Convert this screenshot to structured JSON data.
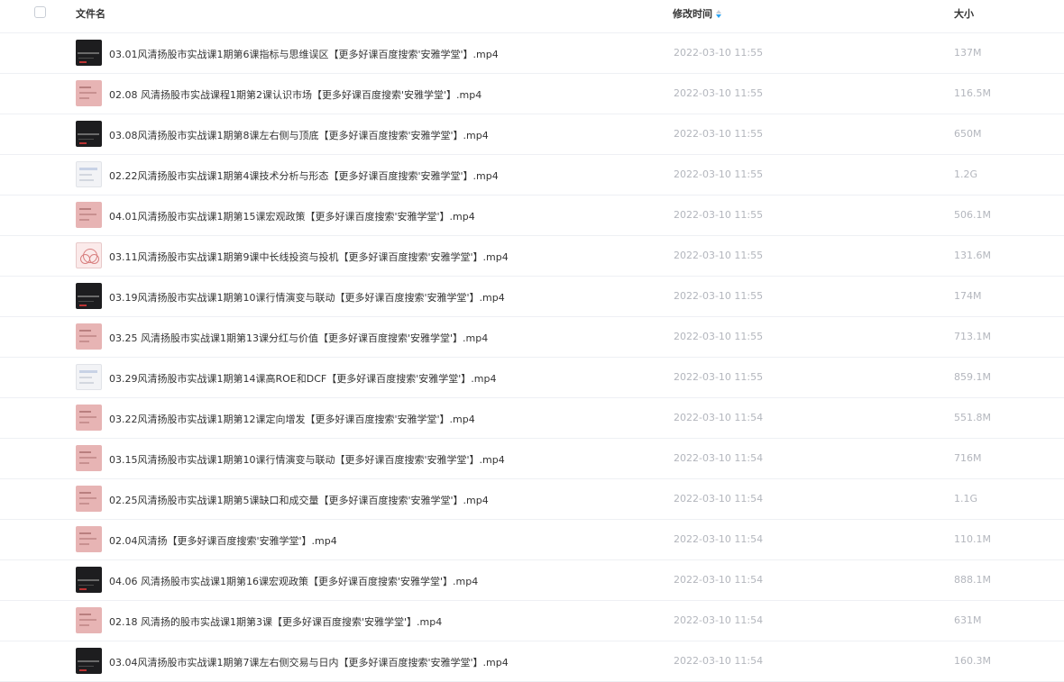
{
  "header": {
    "name_label": "文件名",
    "time_label": "修改时间",
    "size_label": "大小"
  },
  "files": [
    {
      "name": "03.01风清扬股市实战课1期第6课指标与思维误区【更多好课百度搜索'安雅学堂'】.mp4",
      "time": "2022-03-10 11:55",
      "size": "137M",
      "thumb": "dark"
    },
    {
      "name": "02.08 风清扬股市实战课程1期第2课认识市场【更多好课百度搜索'安雅学堂'】.mp4",
      "time": "2022-03-10 11:55",
      "size": "116.5M",
      "thumb": "pink"
    },
    {
      "name": "03.08风清扬股市实战课1期第8课左右侧与顶底【更多好课百度搜索'安雅学堂'】.mp4",
      "time": "2022-03-10 11:55",
      "size": "650M",
      "thumb": "dark"
    },
    {
      "name": "02.22风清扬股市实战课1期第4课技术分析与形态【更多好课百度搜索'安雅学堂'】.mp4",
      "time": "2022-03-10 11:55",
      "size": "1.2G",
      "thumb": "light"
    },
    {
      "name": "04.01风清扬股市实战课1期第15课宏观政策【更多好课百度搜索'安雅学堂'】.mp4",
      "time": "2022-03-10 11:55",
      "size": "506.1M",
      "thumb": "pink"
    },
    {
      "name": "03.11风清扬股市实战课1期第9课中长线投资与投机【更多好课百度搜索'安雅学堂'】.mp4",
      "time": "2022-03-10 11:55",
      "size": "131.6M",
      "thumb": "diagram"
    },
    {
      "name": "03.19风清扬股市实战课1期第10课行情演变与联动【更多好课百度搜索'安雅学堂'】.mp4",
      "time": "2022-03-10 11:55",
      "size": "174M",
      "thumb": "dark"
    },
    {
      "name": "03.25 风清扬股市实战课1期第13课分红与价值【更多好课百度搜索'安雅学堂'】.mp4",
      "time": "2022-03-10 11:55",
      "size": "713.1M",
      "thumb": "pink"
    },
    {
      "name": "03.29风清扬股市实战课1期第14课高ROE和DCF【更多好课百度搜索'安雅学堂'】.mp4",
      "time": "2022-03-10 11:55",
      "size": "859.1M",
      "thumb": "light"
    },
    {
      "name": "03.22风清扬股市实战课1期第12课定向增发【更多好课百度搜索'安雅学堂'】.mp4",
      "time": "2022-03-10 11:54",
      "size": "551.8M",
      "thumb": "pink"
    },
    {
      "name": "03.15风清扬股市实战课1期第10课行情演变与联动【更多好课百度搜索'安雅学堂'】.mp4",
      "time": "2022-03-10 11:54",
      "size": "716M",
      "thumb": "pink"
    },
    {
      "name": "02.25风清扬股市实战课1期第5课缺口和成交量【更多好课百度搜索'安雅学堂'】.mp4",
      "time": "2022-03-10 11:54",
      "size": "1.1G",
      "thumb": "pink"
    },
    {
      "name": "02.04风清扬【更多好课百度搜索'安雅学堂'】.mp4",
      "time": "2022-03-10 11:54",
      "size": "110.1M",
      "thumb": "pink"
    },
    {
      "name": "04.06 风清扬股市实战课1期第16课宏观政策【更多好课百度搜索'安雅学堂'】.mp4",
      "time": "2022-03-10 11:54",
      "size": "888.1M",
      "thumb": "dark"
    },
    {
      "name": "02.18 风清扬的股市实战课1期第3课【更多好课百度搜索'安雅学堂'】.mp4",
      "time": "2022-03-10 11:54",
      "size": "631M",
      "thumb": "pink"
    },
    {
      "name": "03.04风清扬股市实战课1期第7课左右侧交易与日内【更多好课百度搜索'安雅学堂'】.mp4",
      "time": "2022-03-10 11:54",
      "size": "160.3M",
      "thumb": "dark"
    }
  ]
}
